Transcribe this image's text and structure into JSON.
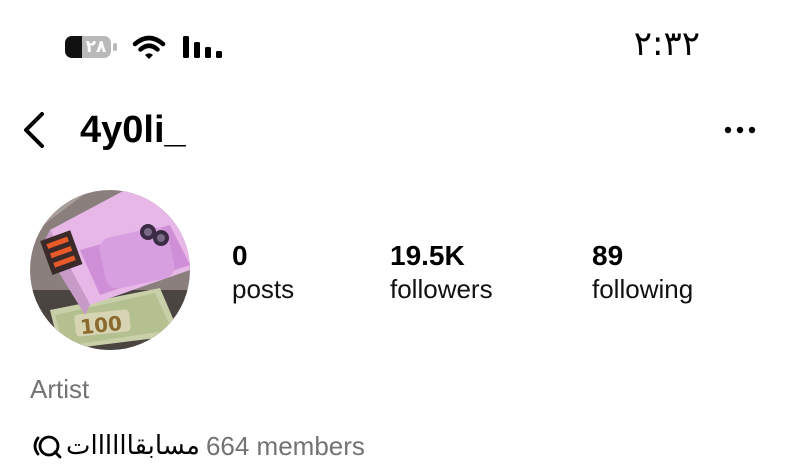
{
  "status_bar": {
    "time": "۲:۳۲",
    "battery_level": "۲۸",
    "icons": [
      "battery-icon",
      "wifi-icon",
      "signal-icon"
    ]
  },
  "header": {
    "username": "4y0li_",
    "back_icon": "chevron-left-icon",
    "more_icon": "more-horizontal-icon"
  },
  "profile": {
    "stats": [
      {
        "value": "0",
        "label": "posts"
      },
      {
        "value": "19.5K",
        "label": "followers"
      },
      {
        "value": "89",
        "label": "following"
      }
    ],
    "category": "Artist",
    "channel": {
      "name": "مسابقاااااات",
      "members": "664 members",
      "icon": "broadcast-channel-icon"
    }
  },
  "colors": {
    "text": "#000000",
    "secondary_text": "#737373",
    "background": "#ffffff"
  }
}
